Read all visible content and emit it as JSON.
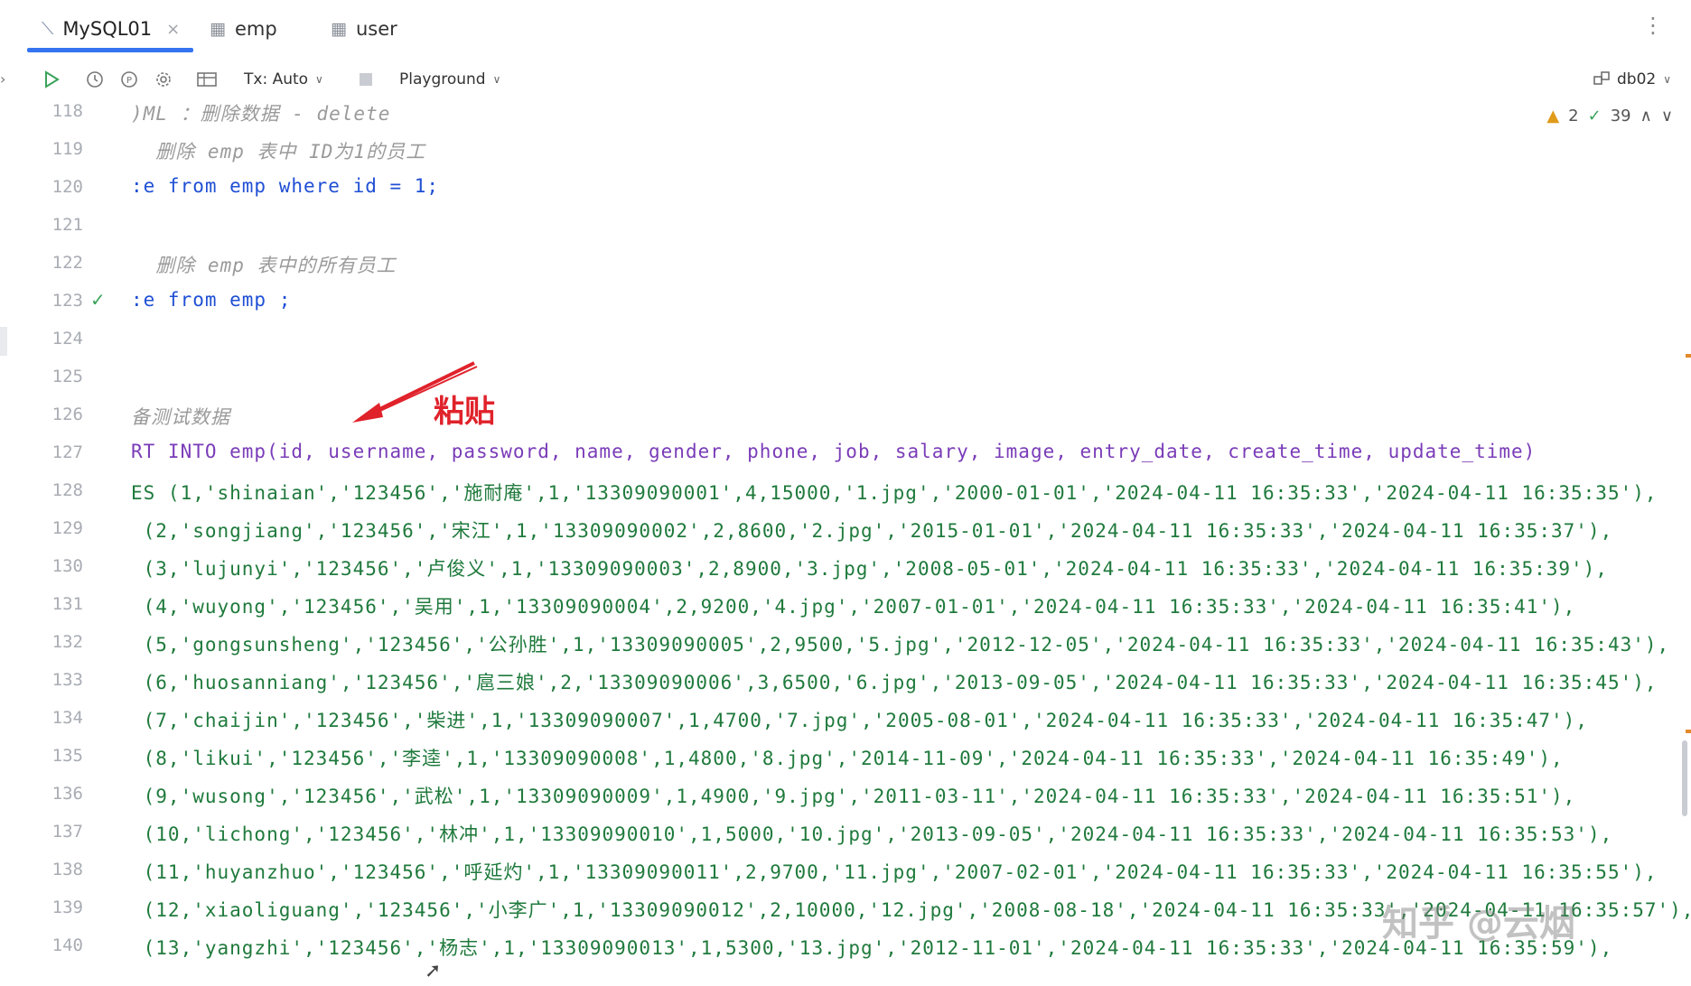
{
  "tabs": [
    {
      "label": "MySQL01",
      "icon": "console-icon",
      "close": "×"
    },
    {
      "label": "emp",
      "icon": "table-icon"
    },
    {
      "label": "user",
      "icon": "table-icon"
    }
  ],
  "toolbar": {
    "tx_label": "Tx: Auto",
    "playground_label": "Playground",
    "datasource_label": "db02"
  },
  "inspections": {
    "warnings": "2",
    "ok": "39"
  },
  "annotation": "粘贴",
  "watermark": "知乎 @云烟",
  "lines": [
    {
      "n": "118",
      "c": ")ML ：删除数据 - delete"
    },
    {
      "n": "119",
      "c": "  删除 emp 表中 ID为1的员工"
    },
    {
      "n": "120",
      "c": ":e from emp where id = 1;"
    },
    {
      "n": "121",
      "c": ""
    },
    {
      "n": "122",
      "c": "  删除 emp 表中的所有员工"
    },
    {
      "n": "123",
      "c": ":e from emp ;"
    },
    {
      "n": "124",
      "c": ""
    },
    {
      "n": "125",
      "c": ""
    },
    {
      "n": "126",
      "c": "备测试数据"
    },
    {
      "n": "127",
      "c": "RT INTO emp(id, username, password, name, gender, phone, job, salary, image, entry_date, create_time, update_time)"
    },
    {
      "n": "128",
      "c": "ES (1,'shinaian','123456','施耐庵',1,'13309090001',4,15000,'1.jpg','2000-01-01','2024-04-11 16:35:33','2024-04-11 16:35:35'),"
    },
    {
      "n": "129",
      "c": " (2,'songjiang','123456','宋江',1,'13309090002',2,8600,'2.jpg','2015-01-01','2024-04-11 16:35:33','2024-04-11 16:35:37'),"
    },
    {
      "n": "130",
      "c": " (3,'lujunyi','123456','卢俊义',1,'13309090003',2,8900,'3.jpg','2008-05-01','2024-04-11 16:35:33','2024-04-11 16:35:39'),"
    },
    {
      "n": "131",
      "c": " (4,'wuyong','123456','吴用',1,'13309090004',2,9200,'4.jpg','2007-01-01','2024-04-11 16:35:33','2024-04-11 16:35:41'),"
    },
    {
      "n": "132",
      "c": " (5,'gongsunsheng','123456','公孙胜',1,'13309090005',2,9500,'5.jpg','2012-12-05','2024-04-11 16:35:33','2024-04-11 16:35:43'),"
    },
    {
      "n": "133",
      "c": " (6,'huosanniang','123456','扈三娘',2,'13309090006',3,6500,'6.jpg','2013-09-05','2024-04-11 16:35:33','2024-04-11 16:35:45'),"
    },
    {
      "n": "134",
      "c": " (7,'chaijin','123456','柴进',1,'13309090007',1,4700,'7.jpg','2005-08-01','2024-04-11 16:35:33','2024-04-11 16:35:47'),"
    },
    {
      "n": "135",
      "c": " (8,'likui','123456','李逵',1,'13309090008',1,4800,'8.jpg','2014-11-09','2024-04-11 16:35:33','2024-04-11 16:35:49'),"
    },
    {
      "n": "136",
      "c": " (9,'wusong','123456','武松',1,'13309090009',1,4900,'9.jpg','2011-03-11','2024-04-11 16:35:33','2024-04-11 16:35:51'),"
    },
    {
      "n": "137",
      "c": " (10,'lichong','123456','林冲',1,'13309090010',1,5000,'10.jpg','2013-09-05','2024-04-11 16:35:33','2024-04-11 16:35:53'),"
    },
    {
      "n": "138",
      "c": " (11,'huyanzhuo','123456','呼延灼',1,'13309090011',2,9700,'11.jpg','2007-02-01','2024-04-11 16:35:33','2024-04-11 16:35:55'),"
    },
    {
      "n": "139",
      "c": " (12,'xiaoliguang','123456','小李广',1,'13309090012',2,10000,'12.jpg','2008-08-18','2024-04-11 16:35:33','2024-04-11 16:35:57'),"
    },
    {
      "n": "140",
      "c": " (13,'yangzhi','123456','杨志',1,'13309090013',1,5300,'13.jpg','2012-11-01','2024-04-11 16:35:33','2024-04-11 16:35:59'),"
    }
  ]
}
